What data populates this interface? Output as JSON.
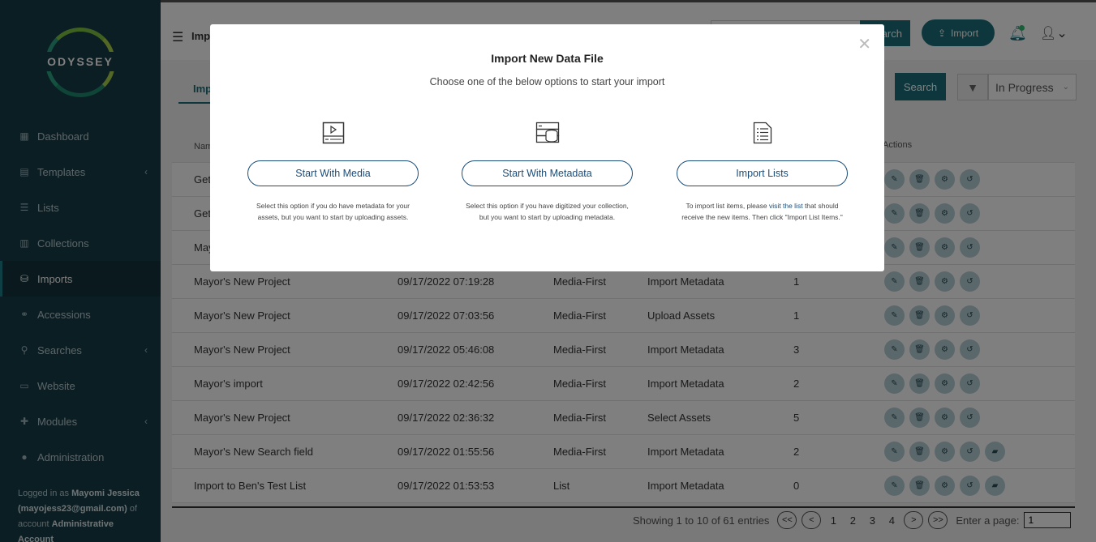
{
  "sidebar": {
    "logo_text": "ODYSSEY",
    "items": [
      {
        "label": "Dashboard",
        "icon": "dashboard-icon"
      },
      {
        "label": "Templates",
        "icon": "file-icon"
      },
      {
        "label": "Lists",
        "icon": "list-icon"
      },
      {
        "label": "Collections",
        "icon": "collection-icon"
      },
      {
        "label": "Imports",
        "icon": "database-icon"
      },
      {
        "label": "Accessions",
        "icon": "handshake-icon"
      },
      {
        "label": "Searches",
        "icon": "search-icon"
      },
      {
        "label": "Website",
        "icon": "laptop-icon"
      },
      {
        "label": "Modules",
        "icon": "puzzle-icon"
      },
      {
        "label": "Administration",
        "icon": "user-icon"
      }
    ],
    "logged_prefix": "Logged in as",
    "logged_user": "Mayomi Jessica",
    "logged_email": "(mayojess23@gmail.com)",
    "logged_of": "of",
    "logged_account_prefix": "account",
    "logged_account": "Administrative Account"
  },
  "topbar": {
    "page_title": "Imp",
    "search_label": "arch",
    "import_label": "Import"
  },
  "toolbar": {
    "tab_label": "Imp",
    "search_label": "Search",
    "status_value": "In Progress"
  },
  "table": {
    "header_name": "Nam",
    "header_actions": "Actions",
    "rows": [
      {
        "name": "Get",
        "date": "",
        "type": "",
        "step": "",
        "count": ""
      },
      {
        "name": "Get",
        "date": "",
        "type": "",
        "step": "",
        "count": ""
      },
      {
        "name": "May",
        "date": "",
        "type": "",
        "step": "",
        "count": ""
      },
      {
        "name": "Mayor's New Project",
        "date": "09/17/2022 07:19:28",
        "type": "Media-First",
        "step": "Import Metadata",
        "count": "1"
      },
      {
        "name": "Mayor's New Project",
        "date": "09/17/2022 07:03:56",
        "type": "Media-First",
        "step": "Upload Assets",
        "count": "1"
      },
      {
        "name": "Mayor's New Project",
        "date": "09/17/2022 05:46:08",
        "type": "Media-First",
        "step": "Import Metadata",
        "count": "3"
      },
      {
        "name": "Mayor's import",
        "date": "09/17/2022 02:42:56",
        "type": "Media-First",
        "step": "Import Metadata",
        "count": "2"
      },
      {
        "name": "Mayor's New Project",
        "date": "09/17/2022 02:36:32",
        "type": "Media-First",
        "step": "Select Assets",
        "count": "5"
      },
      {
        "name": "Mayor's New Search field",
        "date": "09/17/2022 01:55:56",
        "type": "Media-First",
        "step": "Import Metadata",
        "count": "2"
      },
      {
        "name": "Import to Ben's Test List",
        "date": "09/17/2022 01:53:53",
        "type": "List",
        "step": "Import Metadata",
        "count": "0"
      }
    ]
  },
  "pager": {
    "summary": "Showing 1 to 10 of 61 entries",
    "first": "<<",
    "prev": "<",
    "pages": [
      "1",
      "2",
      "3",
      "4"
    ],
    "next": ">",
    "last": ">>",
    "enter_label": "Enter a page:",
    "page_value": "1"
  },
  "modal": {
    "title": "Import New Data File",
    "subtitle": "Choose one of the below options to start your import",
    "options": [
      {
        "button": "Start With Media",
        "icon": "video-file-icon",
        "desc": "Select this option if you do have metadata for your assets, but you want to start by uploading assets."
      },
      {
        "button": "Start With Metadata",
        "icon": "database-icon",
        "desc": "Select this option if you have digitized your collection, but you want to start by uploading metadata."
      },
      {
        "button": "Import Lists",
        "icon": "list-document-icon",
        "desc_before": "To import list items, please",
        "desc_link": "visit the list",
        "desc_after": "that should receive the new items. Then click \"Import List Items.\""
      }
    ]
  }
}
